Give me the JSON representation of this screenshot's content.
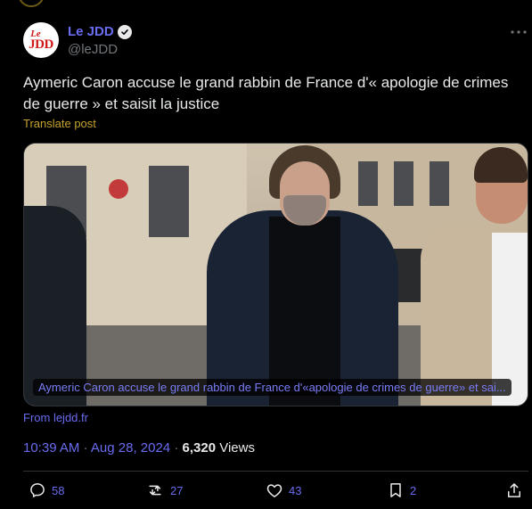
{
  "post": {
    "author_name": "Le JDD",
    "author_handle": "@leJDD",
    "avatar_text_line1": "Le",
    "avatar_text_line2": "JDD",
    "text": "Aymeric Caron accuse le grand rabbin de France d'« apologie de crimes de guerre » et saisit la justice",
    "translate_label": "Translate post",
    "card_caption": "Aymeric Caron accuse le grand rabbin de France d'«apologie de crimes de guerre» et sai...",
    "from_label": "From lejdd.fr",
    "time": "10:39 AM",
    "date": "Aug 28, 2024",
    "views_count": "6,320",
    "views_label": "Views",
    "separator": "·"
  },
  "actions": {
    "replies": "58",
    "reposts": "27",
    "likes": "43",
    "bookmarks": "2"
  },
  "colors": {
    "background": "#000000",
    "text": "#e7e9ea",
    "accent": "#6a6cf0",
    "translate": "#c5a32b",
    "muted": "#71767b",
    "border": "#2f3336"
  },
  "icons": [
    "verified-icon",
    "more-icon",
    "reply-icon",
    "repost-icon",
    "like-icon",
    "bookmark-icon",
    "share-icon"
  ]
}
